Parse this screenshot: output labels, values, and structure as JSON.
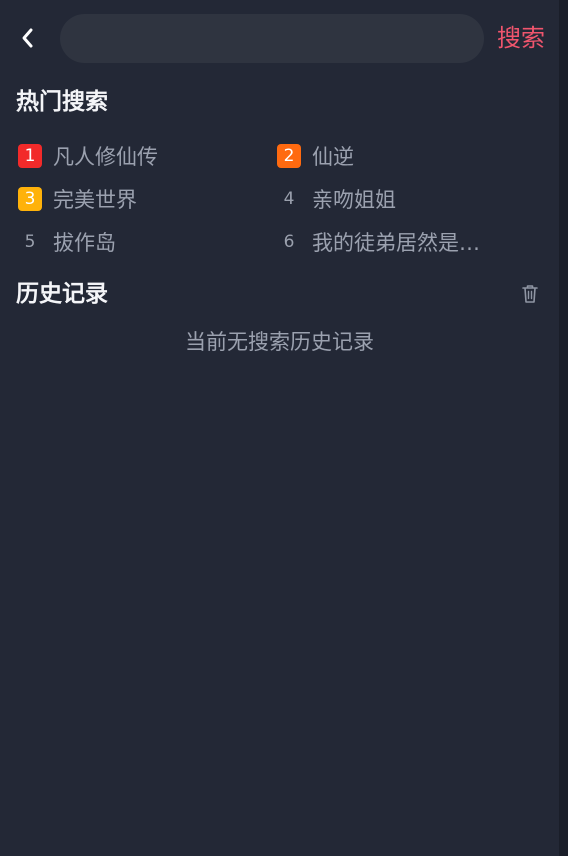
{
  "colors": {
    "background": "#232836",
    "accent": "#f0556d",
    "rank_1": "#f22a2a",
    "rank_2": "#ff6a10",
    "rank_3": "#ffb20a"
  },
  "top_bar": {
    "back_icon": "chevron-left-icon",
    "search_value": "",
    "search_label": "搜索"
  },
  "hot": {
    "title": "热门搜索",
    "items": [
      {
        "rank": "1",
        "text": "凡人修仙传"
      },
      {
        "rank": "2",
        "text": "仙逆"
      },
      {
        "rank": "3",
        "text": "完美世界"
      },
      {
        "rank": "4",
        "text": "亲吻姐姐"
      },
      {
        "rank": "5",
        "text": "拔作岛"
      },
      {
        "rank": "6",
        "text": "我的徒弟居然是…"
      }
    ]
  },
  "history": {
    "title": "历史记录",
    "clear_icon": "trash-icon",
    "empty_text": "当前无搜索历史记录"
  }
}
